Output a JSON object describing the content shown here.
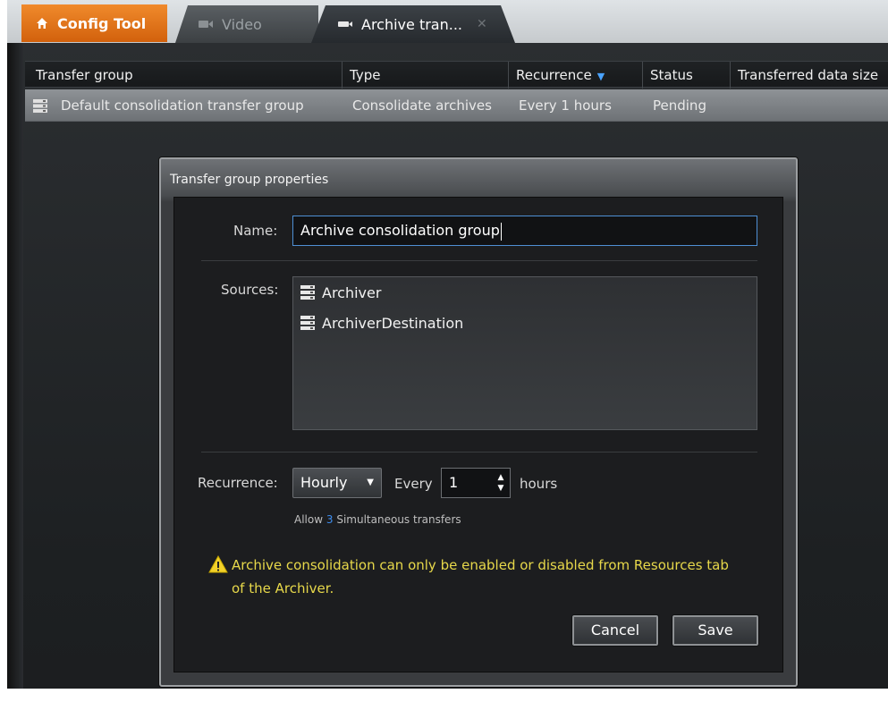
{
  "tabs": [
    {
      "label": "Config Tool",
      "icon": "home-icon"
    },
    {
      "label": "Video",
      "icon": "video-icon"
    },
    {
      "label": "Archive tran...",
      "icon": "archive-transfer-icon"
    }
  ],
  "grid": {
    "columns": [
      "Transfer group",
      "Type",
      "Recurrence",
      "Status",
      "Transferred data size"
    ],
    "sorted_column": "Recurrence",
    "rows": [
      {
        "transfer_group": "Default consolidation transfer group",
        "type": "Consolidate archives",
        "recurrence": "Every 1 hours",
        "status": "Pending",
        "icon": "server-stack-icon"
      }
    ]
  },
  "dialog": {
    "title": "Transfer group properties",
    "name_label": "Name:",
    "name_value": "Archive consolidation group",
    "sources_label": "Sources:",
    "sources": [
      {
        "label": "Archiver",
        "icon": "server-stack-icon"
      },
      {
        "label": "ArchiverDestination",
        "icon": "server-stack-icon"
      }
    ],
    "recurrence_label": "Recurrence:",
    "recurrence_value": "Hourly",
    "every_label": "Every",
    "every_value": "1",
    "hours_label": "hours",
    "allow_prefix": "Allow",
    "allow_value": "3",
    "allow_suffix": "Simultaneous transfers",
    "warning_line1": "Archive consolidation can only be enabled or disabled from Resources tab",
    "warning_line2": "of the Archiver.",
    "cancel_label": "Cancel",
    "save_label": "Save"
  },
  "colors": {
    "accent_orange": "#e8761a",
    "selection_blue": "#4e8fd4",
    "warning_yellow": "#e7d84a"
  }
}
